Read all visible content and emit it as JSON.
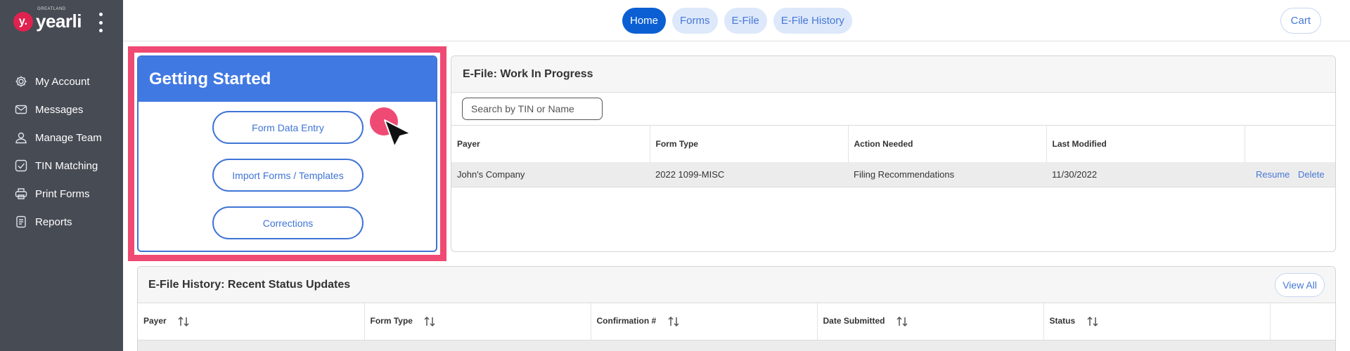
{
  "brand": {
    "mark": "y.",
    "sub": "GREATLAND",
    "word": "yearli"
  },
  "sidebar": {
    "items": [
      {
        "label": "My Account",
        "icon": "gear-icon"
      },
      {
        "label": "Messages",
        "icon": "envelope-icon"
      },
      {
        "label": "Manage Team",
        "icon": "user-icon"
      },
      {
        "label": "TIN Matching",
        "icon": "check-square-icon"
      },
      {
        "label": "Print Forms",
        "icon": "printer-icon"
      },
      {
        "label": "Reports",
        "icon": "document-icon"
      }
    ]
  },
  "header": {
    "tabs": [
      {
        "label": "Home",
        "active": true
      },
      {
        "label": "Forms",
        "active": false
      },
      {
        "label": "E-File",
        "active": false
      },
      {
        "label": "E-File History",
        "active": false
      }
    ],
    "cart_label": "Cart"
  },
  "getting_started": {
    "title": "Getting Started",
    "buttons": [
      "Form Data Entry",
      "Import Forms / Templates",
      "Corrections"
    ]
  },
  "wip": {
    "title": "E-File: Work In Progress",
    "search_placeholder": "Search by TIN or Name",
    "columns": [
      "Payer",
      "Form Type",
      "Action Needed",
      "Last Modified"
    ],
    "rows": [
      {
        "payer": "John's Company",
        "form_type": "2022 1099-MISC",
        "action": "Filing Recommendations",
        "modified": "11/30/2022",
        "resume": "Resume",
        "delete": "Delete"
      }
    ]
  },
  "history": {
    "title": "E-File History: Recent Status Updates",
    "view_all": "View All",
    "columns": [
      "Payer",
      "Form Type",
      "Confirmation #",
      "Date Submitted",
      "Status"
    ]
  },
  "colors": {
    "accent": "#4179e2",
    "highlight": "#ef4a73",
    "sidebar": "#474b54"
  }
}
